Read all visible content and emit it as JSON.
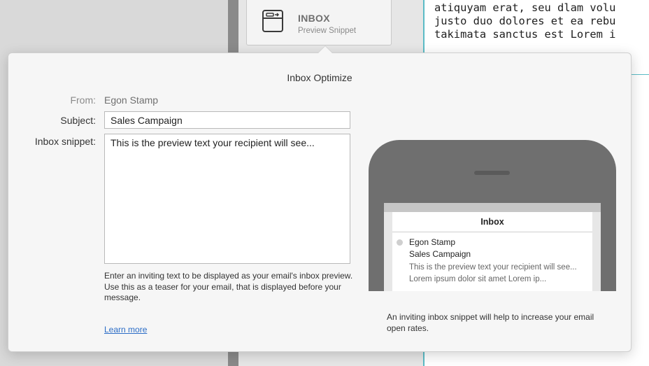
{
  "background": {
    "inbox_card": {
      "icon": "inbox-icon",
      "title": "INBOX",
      "subtitle": "Preview Snippet"
    },
    "editor_text": "atiquyam erat, seu dlam volu\njusto duo dolores et ea rebu\ntakimata sanctus est Lorem i"
  },
  "popover": {
    "title": "Inbox Optimize",
    "from_label": "From:",
    "from_value": "Egon Stamp",
    "subject_label": "Subject:",
    "subject_value": "Sales Campaign",
    "snippet_label": "Inbox snippet:",
    "snippet_value": "This is the preview text your recipient will see...",
    "snippet_help": "Enter an inviting text to be displayed as your email's inbox preview. Use this as a teaser for your email, that is displayed before your message.",
    "learn_more": "Learn more"
  },
  "preview": {
    "header": "Inbox",
    "sender": "Egon Stamp",
    "subject": "Sales Campaign",
    "preview_text": "This is the preview text your recipient will see... Lorem ipsum dolor sit amet Lorem ip...",
    "note": "An inviting inbox snippet will help to increase your email open rates."
  },
  "colors": {
    "accent_link": "#2a6cc6",
    "editor_rule": "#5bbcc6",
    "phone_body": "#6f6f6f"
  }
}
